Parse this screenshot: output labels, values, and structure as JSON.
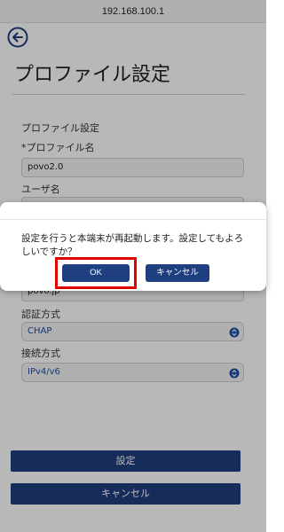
{
  "browser": {
    "url": "192.168.100.1"
  },
  "page": {
    "title": "プロファイル設定"
  },
  "form": {
    "section_label": "プロファイル設定",
    "profile_name_label": "*プロファイル名",
    "profile_name_value": "povo2.0",
    "username_label": "ユーザ名",
    "apn_value": "povo.jp",
    "auth_label": "認証方式",
    "auth_value": "CHAP",
    "conn_label": "接続方式",
    "conn_value": "IPv4/v6"
  },
  "buttons": {
    "settings": "設定",
    "cancel": "キャンセル"
  },
  "dialog": {
    "message": "設定を行うと本端末が再起動します。設定してもよろしいですか？",
    "ok": "OK",
    "cancel": "キャンセル"
  },
  "colors": {
    "primary": "#1f3f7f",
    "link": "#1d4fa6",
    "highlight": "#e00000"
  }
}
